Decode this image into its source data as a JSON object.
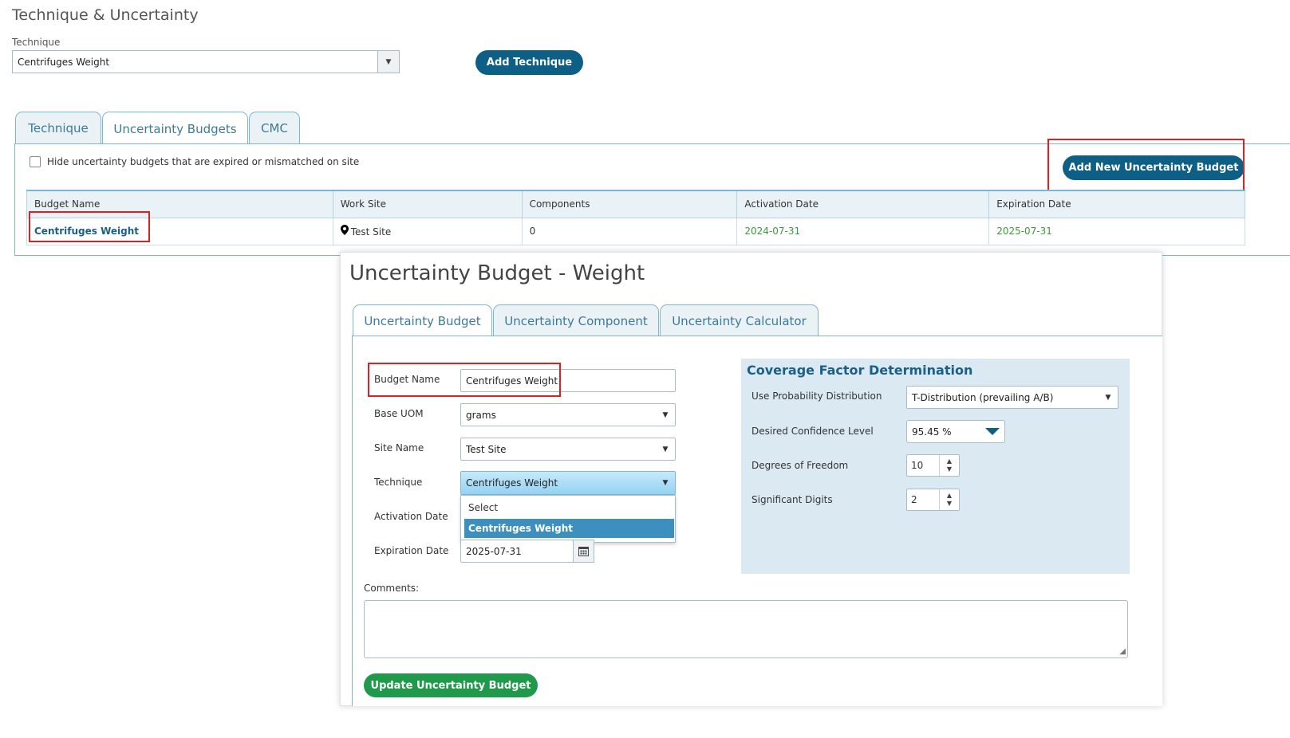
{
  "page": {
    "title": "Technique & Uncertainty",
    "technique_label": "Technique",
    "technique_value": "Centrifuges Weight",
    "add_technique_label": "Add Technique"
  },
  "tabs": [
    {
      "label": "Technique",
      "active": false
    },
    {
      "label": "Uncertainty Budgets",
      "active": true
    },
    {
      "label": "CMC",
      "active": false
    }
  ],
  "budgets": {
    "hide_label": "Hide uncertainty budgets that are expired or mismatched on site",
    "add_button_label": "Add New Uncertainty Budget",
    "columns": [
      "Budget Name",
      "Work Site",
      "Components",
      "Activation Date",
      "Expiration Date"
    ],
    "rows": [
      {
        "name": "Centrifuges Weight",
        "site": "Test Site",
        "components": "0",
        "activation": "2024-07-31",
        "expiration": "2025-07-31"
      }
    ]
  },
  "modal": {
    "title": "Uncertainty Budget - Weight",
    "tabs": [
      {
        "label": "Uncertainty Budget",
        "active": true
      },
      {
        "label": "Uncertainty Component",
        "active": false
      },
      {
        "label": "Uncertainty Calculator",
        "active": false
      }
    ],
    "form": {
      "budget_name_label": "Budget Name",
      "budget_name_value": "Centrifuges Weight",
      "base_uom_label": "Base UOM",
      "base_uom_value": "grams",
      "site_label": "Site Name",
      "site_value": "Test Site",
      "technique_label": "Technique",
      "technique_value": "Centrifuges Weight",
      "technique_options": [
        "Select",
        "Centrifuges Weight"
      ],
      "activation_label": "Activation Date",
      "expiration_label": "Expiration Date",
      "expiration_value": "2025-07-31",
      "comments_label": "Comments:"
    },
    "coverage": {
      "title": "Coverage Factor Determination",
      "distribution_label": "Use Probability Distribution",
      "distribution_value": "T-Distribution (prevailing A/B)",
      "confidence_label": "Desired Confidence Level",
      "confidence_value": "95.45 %",
      "dof_label": "Degrees of Freedom",
      "dof_value": "10",
      "sigdig_label": "Significant Digits",
      "sigdig_value": "2"
    },
    "update_button_label": "Update Uncertainty Budget"
  },
  "colors": {
    "primary_button": "#0d5f86",
    "success_button": "#1e9a4a",
    "highlight_box": "#e02020",
    "tab_border": "#7fb6cf",
    "panel_background": "#dbeaf2"
  },
  "icons": [
    "chevron-down-icon",
    "map-pin-icon",
    "calendar-icon",
    "spinner-arrows-icon",
    "resize-grip-icon"
  ]
}
